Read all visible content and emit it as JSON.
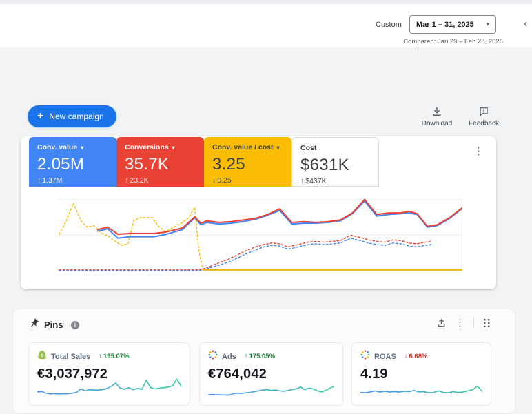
{
  "icons": {
    "plus": "+",
    "caret_down": "▾",
    "kebab": "⋮",
    "chevron_left": "‹",
    "info": "i",
    "up_arrow": "↑",
    "down_arrow": "↓"
  },
  "header": {
    "custom_label": "Custom",
    "date_range": "Mar 1 – 31, 2025",
    "compared": "Compared: Jan 29 – Feb 28, 2025"
  },
  "toolbar": {
    "new_campaign": "New campaign",
    "download": "Download",
    "feedback": "Feedback"
  },
  "scorecards": [
    {
      "label": "Conv. value",
      "caret": "▾",
      "value": "2.05M",
      "arrow": "↑",
      "delta": "1.37M",
      "bg": "#4285F4",
      "fg": "#ffffff",
      "bordered": false
    },
    {
      "label": "Conversions",
      "caret": "▾",
      "value": "35.7K",
      "arrow": "↑",
      "delta": "23.2K",
      "bg": "#EA4335",
      "fg": "#ffffff",
      "bordered": false
    },
    {
      "label": "Conv. value / cost",
      "caret": "▾",
      "value": "3.25",
      "arrow": "↓",
      "delta": "0.25",
      "bg": "#FBBC04",
      "fg": "#3c4043",
      "bordered": false
    },
    {
      "label": "Cost",
      "caret": "",
      "value": "$631K",
      "arrow": "↑",
      "delta": "$437K",
      "bg": "#ffffff",
      "fg": "#3c4043",
      "bordered": true
    }
  ],
  "chart_data": [
    {
      "type": "line",
      "title": "Campaign performance over Mar 1 – 31, 2025 vs compared period (no axis tick labels visible)",
      "xlabel": "",
      "ylabel": "",
      "x_range_percent": [
        0,
        100
      ],
      "value_range_percent": [
        0,
        100
      ],
      "grid": "two light horizontal gridlines plus baseline",
      "legend_position": "none (colors match scorecards above)",
      "series": [
        {
          "name": "Conv. value / cost — previous period",
          "color": "#FBBC04",
          "dash": true,
          "width": 1.4,
          "points": [
            [
              0.5,
              46
            ],
            [
              2,
              60
            ],
            [
              4,
              85
            ],
            [
              6,
              62
            ],
            [
              7.5,
              55
            ],
            [
              9,
              57
            ],
            [
              11,
              47
            ],
            [
              12.5,
              44
            ],
            [
              14,
              38
            ],
            [
              16,
              32
            ],
            [
              17.5,
              34
            ],
            [
              19,
              64
            ],
            [
              20.5,
              67
            ],
            [
              22,
              67
            ],
            [
              23.5,
              67
            ],
            [
              25,
              56
            ],
            [
              26.5,
              50
            ],
            [
              28,
              52
            ],
            [
              29.5,
              57
            ],
            [
              31,
              61
            ],
            [
              32.5,
              67
            ],
            [
              34,
              80
            ],
            [
              35,
              26
            ],
            [
              36,
              2
            ]
          ]
        },
        {
          "name": "Conv. value — previous period",
          "color": "#4285F4",
          "dash": true,
          "width": 1.4,
          "points": [
            [
              0.5,
              0
            ],
            [
              5,
              0
            ],
            [
              10,
              0
            ],
            [
              15,
              0
            ],
            [
              20,
              0
            ],
            [
              25,
              0
            ],
            [
              30,
              0
            ],
            [
              34,
              0
            ],
            [
              36,
              1
            ],
            [
              38,
              4
            ],
            [
              40,
              7
            ],
            [
              42.5,
              11
            ],
            [
              45,
              17
            ],
            [
              47,
              22
            ],
            [
              49,
              26
            ],
            [
              51,
              30
            ],
            [
              53,
              32
            ],
            [
              55,
              31
            ],
            [
              57,
              27
            ],
            [
              59.5,
              30
            ],
            [
              62,
              33
            ],
            [
              64,
              34
            ],
            [
              66,
              33
            ],
            [
              68,
              34
            ],
            [
              70,
              35
            ],
            [
              72.5,
              41
            ],
            [
              75,
              38
            ],
            [
              77,
              35
            ],
            [
              79,
              33
            ],
            [
              81,
              32
            ],
            [
              83,
              35
            ],
            [
              85,
              34
            ],
            [
              87,
              31
            ],
            [
              89,
              30
            ],
            [
              91,
              32
            ],
            [
              92.5,
              33
            ]
          ]
        },
        {
          "name": "Conversions — previous period",
          "color": "#EA4335",
          "dash": true,
          "width": 1.4,
          "points": [
            [
              0.5,
              1
            ],
            [
              5,
              1
            ],
            [
              10,
              1
            ],
            [
              15,
              1
            ],
            [
              20,
              1
            ],
            [
              25,
              1
            ],
            [
              30,
              1
            ],
            [
              34,
              1
            ],
            [
              36,
              2
            ],
            [
              38,
              6
            ],
            [
              40,
              10
            ],
            [
              42.5,
              15
            ],
            [
              45,
              21
            ],
            [
              47,
              26
            ],
            [
              49,
              30
            ],
            [
              51,
              33
            ],
            [
              53,
              35
            ],
            [
              55,
              34
            ],
            [
              57,
              30
            ],
            [
              59.5,
              33
            ],
            [
              62,
              36
            ],
            [
              64,
              37
            ],
            [
              66,
              36
            ],
            [
              68,
              37
            ],
            [
              70,
              38
            ],
            [
              72.5,
              45
            ],
            [
              75,
              42
            ],
            [
              77,
              39
            ],
            [
              79,
              37
            ],
            [
              81,
              36
            ],
            [
              83,
              39
            ],
            [
              85,
              38
            ],
            [
              87,
              35
            ],
            [
              89,
              34
            ],
            [
              91,
              36
            ],
            [
              92.5,
              37
            ]
          ]
        },
        {
          "name": "Conv. value / cost — current (3.25)",
          "color": "#F9AB00",
          "dash": false,
          "width": 2,
          "points": [
            [
              36,
              1
            ],
            [
              100,
              1
            ]
          ]
        },
        {
          "name": "Conv. value — current (2.05M)",
          "color": "#4285F4",
          "dash": false,
          "width": 2,
          "points": [
            [
              10,
              50
            ],
            [
              12.5,
              53
            ],
            [
              15,
              41
            ],
            [
              18,
              43
            ],
            [
              21,
              43
            ],
            [
              24,
              43
            ],
            [
              27,
              46
            ],
            [
              31,
              52
            ],
            [
              34,
              67
            ],
            [
              35.5,
              58
            ],
            [
              37,
              61
            ],
            [
              40,
              59
            ],
            [
              43,
              60
            ],
            [
              46,
              62
            ],
            [
              49,
              65
            ],
            [
              52,
              70
            ],
            [
              55,
              76
            ],
            [
              58,
              59
            ],
            [
              61,
              60
            ],
            [
              64,
              60
            ],
            [
              67,
              61
            ],
            [
              70,
              63
            ],
            [
              73,
              72
            ],
            [
              76,
              88
            ],
            [
              79,
              69
            ],
            [
              82,
              71
            ],
            [
              85,
              72
            ],
            [
              87,
              73
            ],
            [
              89,
              71
            ],
            [
              91.5,
              55
            ],
            [
              94,
              57
            ],
            [
              97,
              66
            ],
            [
              100,
              78
            ]
          ]
        },
        {
          "name": "Conversions — current (35.7K)",
          "color": "#EA4335",
          "dash": false,
          "width": 2,
          "points": [
            [
              10,
              52
            ],
            [
              12.5,
              55
            ],
            [
              15,
              46
            ],
            [
              18,
              47
            ],
            [
              21,
              47
            ],
            [
              24,
              47
            ],
            [
              27,
              49
            ],
            [
              31,
              54
            ],
            [
              34,
              68
            ],
            [
              35.5,
              60
            ],
            [
              37,
              63
            ],
            [
              40,
              61
            ],
            [
              43,
              62
            ],
            [
              46,
              64
            ],
            [
              49,
              66
            ],
            [
              52,
              71
            ],
            [
              55,
              78
            ],
            [
              58,
              61
            ],
            [
              61,
              62
            ],
            [
              64,
              61
            ],
            [
              67,
              62
            ],
            [
              70,
              64
            ],
            [
              73,
              73
            ],
            [
              76,
              90
            ],
            [
              79,
              71
            ],
            [
              82,
              73
            ],
            [
              85,
              73
            ],
            [
              87,
              75
            ],
            [
              89,
              72
            ],
            [
              91.5,
              56
            ],
            [
              94,
              58
            ],
            [
              97,
              67
            ],
            [
              100,
              79
            ]
          ]
        }
      ]
    },
    {
      "type": "line",
      "title": "Total Sales sparkline",
      "gradient": [
        "#4c8bf5",
        "#34d29c"
      ],
      "values": [
        32,
        35,
        26,
        22,
        24,
        22,
        23,
        23,
        26,
        30,
        48,
        38,
        44,
        42,
        42,
        44,
        50,
        62,
        78,
        52,
        46,
        54,
        44,
        50,
        46,
        92,
        54,
        48,
        52,
        54,
        58,
        64,
        98,
        62
      ]
    },
    {
      "type": "line",
      "title": "Ads sparkline",
      "gradient": [
        "#4c8bf5",
        "#34d29c"
      ],
      "values": [
        18,
        19,
        18,
        17,
        17,
        16,
        24,
        26,
        25,
        28,
        30,
        34,
        38,
        42,
        44,
        40,
        42,
        38,
        36,
        40,
        44,
        48,
        58,
        44,
        52,
        48,
        38,
        32,
        40,
        52,
        62
      ]
    },
    {
      "type": "line",
      "title": "ROAS sparkline",
      "gradient": [
        "#4c8bf5",
        "#34d29c"
      ],
      "values": [
        30,
        28,
        32,
        38,
        32,
        36,
        32,
        34,
        32,
        36,
        34,
        40,
        32,
        34,
        28,
        30,
        38,
        30,
        28,
        34,
        30,
        32,
        38,
        44,
        62,
        34
      ]
    }
  ],
  "pins": {
    "title": "Pins",
    "cards": [
      {
        "icon": "shopify-bag",
        "label": "Total Sales",
        "arrow": "↑",
        "delta": "195.07%",
        "delta_color": "#188038",
        "value": "€3,037,972"
      },
      {
        "icon": "dotted-circle",
        "label": "Ads",
        "arrow": "↑",
        "delta": "175.05%",
        "delta_color": "#188038",
        "value": "€764,042"
      },
      {
        "icon": "dotted-circle",
        "label": "ROAS",
        "arrow": "↓",
        "delta": "6.68%",
        "delta_color": "#d93025",
        "value": "4.19"
      }
    ]
  }
}
